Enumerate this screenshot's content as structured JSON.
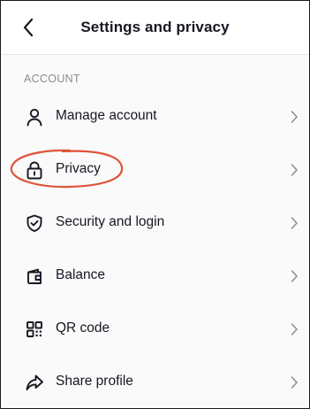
{
  "header": {
    "title": "Settings and privacy"
  },
  "section": {
    "title": "ACCOUNT"
  },
  "items": [
    {
      "label": "Manage account",
      "icon": "person-icon"
    },
    {
      "label": "Privacy",
      "icon": "lock-icon"
    },
    {
      "label": "Security and login",
      "icon": "shield-check-icon"
    },
    {
      "label": "Balance",
      "icon": "wallet-icon"
    },
    {
      "label": "QR code",
      "icon": "qr-code-icon"
    },
    {
      "label": "Share profile",
      "icon": "share-arrow-icon"
    }
  ],
  "colors": {
    "highlight_circle": "#e0533a",
    "text": "#161823",
    "section_label": "#8a8b91"
  }
}
